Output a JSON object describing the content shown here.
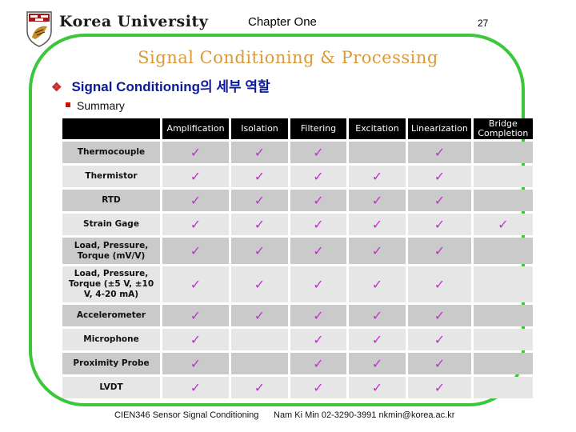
{
  "header": {
    "university": "Korea University",
    "chapter": "Chapter   One",
    "page_number": "27"
  },
  "slide": {
    "title": "Signal Conditioning & Processing",
    "heading": "Signal Conditioning의 세부 역할",
    "heading_bullet": "❖",
    "subheading": "Summary"
  },
  "colors": {
    "frame": "#3cc63c",
    "title": "#d99a3a",
    "heading": "#0a1a9a",
    "check": "#c030d0"
  },
  "table": {
    "check_glyph": "✓",
    "columns": [
      "",
      "Amplification",
      "Isolation",
      "Filtering",
      "Excitation",
      "Linearization",
      "Bridge Completion"
    ],
    "rows": [
      {
        "label": "Thermocouple",
        "checks": [
          true,
          true,
          true,
          false,
          true,
          false
        ]
      },
      {
        "label": "Thermistor",
        "checks": [
          true,
          true,
          true,
          true,
          true,
          false
        ]
      },
      {
        "label": "RTD",
        "checks": [
          true,
          true,
          true,
          true,
          true,
          false
        ]
      },
      {
        "label": "Strain Gage",
        "checks": [
          true,
          true,
          true,
          true,
          true,
          true
        ]
      },
      {
        "label": "Load, Pressure, Torque (mV/V)",
        "checks": [
          true,
          true,
          true,
          true,
          true,
          false
        ]
      },
      {
        "label": "Load, Pressure, Torque (±5 V, ±10 V, 4-20 mA)",
        "checks": [
          true,
          true,
          true,
          true,
          true,
          false
        ]
      },
      {
        "label": "Accelerometer",
        "checks": [
          true,
          true,
          true,
          true,
          true,
          false
        ]
      },
      {
        "label": "Microphone",
        "checks": [
          true,
          false,
          true,
          true,
          true,
          false
        ]
      },
      {
        "label": "Proximity Probe",
        "checks": [
          true,
          false,
          true,
          true,
          true,
          false
        ]
      },
      {
        "label": "LVDT",
        "checks": [
          true,
          true,
          true,
          true,
          true,
          false
        ]
      }
    ]
  },
  "footer": {
    "course": "CIEN346  Sensor Signal Conditioning",
    "contact": "Nam Ki Min   02-3290-3991  nkmin@korea.ac.kr"
  }
}
